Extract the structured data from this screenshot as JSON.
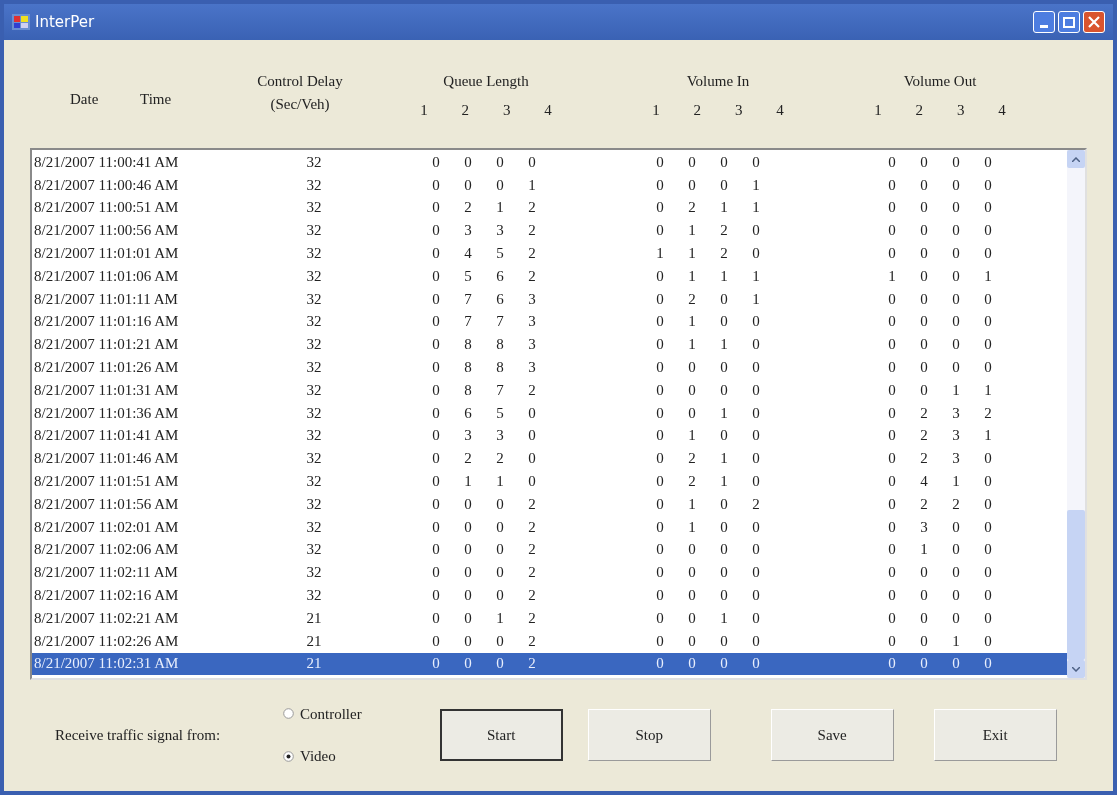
{
  "window": {
    "title": "InterPer"
  },
  "header": {
    "date": "Date",
    "time": "Time",
    "delay": [
      "Control Delay",
      "(Sec/Veh)"
    ],
    "groups": [
      {
        "title": "Queue Length",
        "lanes": [
          "1",
          "2",
          "3",
          "4"
        ]
      },
      {
        "title": "Volume In",
        "lanes": [
          "1",
          "2",
          "3",
          "4"
        ]
      },
      {
        "title": "Volume Out",
        "lanes": [
          "1",
          "2",
          "3",
          "4"
        ]
      }
    ]
  },
  "rows": [
    {
      "timestamp": "8/21/2007 11:00:41 AM",
      "delay": "32",
      "values": [
        "0",
        "0",
        "0",
        "0",
        "0",
        "0",
        "0",
        "0",
        "0",
        "0",
        "0",
        "0"
      ],
      "selected": false
    },
    {
      "timestamp": "8/21/2007 11:00:46 AM",
      "delay": "32",
      "values": [
        "0",
        "0",
        "0",
        "1",
        "0",
        "0",
        "0",
        "1",
        "0",
        "0",
        "0",
        "0"
      ],
      "selected": false
    },
    {
      "timestamp": "8/21/2007 11:00:51 AM",
      "delay": "32",
      "values": [
        "0",
        "2",
        "1",
        "2",
        "0",
        "2",
        "1",
        "1",
        "0",
        "0",
        "0",
        "0"
      ],
      "selected": false
    },
    {
      "timestamp": "8/21/2007 11:00:56 AM",
      "delay": "32",
      "values": [
        "0",
        "3",
        "3",
        "2",
        "0",
        "1",
        "2",
        "0",
        "0",
        "0",
        "0",
        "0"
      ],
      "selected": false
    },
    {
      "timestamp": "8/21/2007 11:01:01 AM",
      "delay": "32",
      "values": [
        "0",
        "4",
        "5",
        "2",
        "1",
        "1",
        "2",
        "0",
        "0",
        "0",
        "0",
        "0"
      ],
      "selected": false
    },
    {
      "timestamp": "8/21/2007 11:01:06 AM",
      "delay": "32",
      "values": [
        "0",
        "5",
        "6",
        "2",
        "0",
        "1",
        "1",
        "1",
        "1",
        "0",
        "0",
        "1"
      ],
      "selected": false
    },
    {
      "timestamp": "8/21/2007 11:01:11 AM",
      "delay": "32",
      "values": [
        "0",
        "7",
        "6",
        "3",
        "0",
        "2",
        "0",
        "1",
        "0",
        "0",
        "0",
        "0"
      ],
      "selected": false
    },
    {
      "timestamp": "8/21/2007 11:01:16 AM",
      "delay": "32",
      "values": [
        "0",
        "7",
        "7",
        "3",
        "0",
        "1",
        "0",
        "0",
        "0",
        "0",
        "0",
        "0"
      ],
      "selected": false
    },
    {
      "timestamp": "8/21/2007 11:01:21 AM",
      "delay": "32",
      "values": [
        "0",
        "8",
        "8",
        "3",
        "0",
        "1",
        "1",
        "0",
        "0",
        "0",
        "0",
        "0"
      ],
      "selected": false
    },
    {
      "timestamp": "8/21/2007 11:01:26 AM",
      "delay": "32",
      "values": [
        "0",
        "8",
        "8",
        "3",
        "0",
        "0",
        "0",
        "0",
        "0",
        "0",
        "0",
        "0"
      ],
      "selected": false
    },
    {
      "timestamp": "8/21/2007 11:01:31 AM",
      "delay": "32",
      "values": [
        "0",
        "8",
        "7",
        "2",
        "0",
        "0",
        "0",
        "0",
        "0",
        "0",
        "1",
        "1"
      ],
      "selected": false
    },
    {
      "timestamp": "8/21/2007 11:01:36 AM",
      "delay": "32",
      "values": [
        "0",
        "6",
        "5",
        "0",
        "0",
        "0",
        "1",
        "0",
        "0",
        "2",
        "3",
        "2"
      ],
      "selected": false
    },
    {
      "timestamp": "8/21/2007 11:01:41 AM",
      "delay": "32",
      "values": [
        "0",
        "3",
        "3",
        "0",
        "0",
        "1",
        "0",
        "0",
        "0",
        "2",
        "3",
        "1"
      ],
      "selected": false
    },
    {
      "timestamp": "8/21/2007 11:01:46 AM",
      "delay": "32",
      "values": [
        "0",
        "2",
        "2",
        "0",
        "0",
        "2",
        "1",
        "0",
        "0",
        "2",
        "3",
        "0"
      ],
      "selected": false
    },
    {
      "timestamp": "8/21/2007 11:01:51 AM",
      "delay": "32",
      "values": [
        "0",
        "1",
        "1",
        "0",
        "0",
        "2",
        "1",
        "0",
        "0",
        "4",
        "1",
        "0"
      ],
      "selected": false
    },
    {
      "timestamp": "8/21/2007 11:01:56 AM",
      "delay": "32",
      "values": [
        "0",
        "0",
        "0",
        "2",
        "0",
        "1",
        "0",
        "2",
        "0",
        "2",
        "2",
        "0"
      ],
      "selected": false
    },
    {
      "timestamp": "8/21/2007 11:02:01 AM",
      "delay": "32",
      "values": [
        "0",
        "0",
        "0",
        "2",
        "0",
        "1",
        "0",
        "0",
        "0",
        "3",
        "0",
        "0"
      ],
      "selected": false
    },
    {
      "timestamp": "8/21/2007 11:02:06 AM",
      "delay": "32",
      "values": [
        "0",
        "0",
        "0",
        "2",
        "0",
        "0",
        "0",
        "0",
        "0",
        "1",
        "0",
        "0"
      ],
      "selected": false
    },
    {
      "timestamp": "8/21/2007 11:02:11 AM",
      "delay": "32",
      "values": [
        "0",
        "0",
        "0",
        "2",
        "0",
        "0",
        "0",
        "0",
        "0",
        "0",
        "0",
        "0"
      ],
      "selected": false
    },
    {
      "timestamp": "8/21/2007 11:02:16 AM",
      "delay": "32",
      "values": [
        "0",
        "0",
        "0",
        "2",
        "0",
        "0",
        "0",
        "0",
        "0",
        "0",
        "0",
        "0"
      ],
      "selected": false
    },
    {
      "timestamp": "8/21/2007 11:02:21 AM",
      "delay": "21",
      "values": [
        "0",
        "0",
        "1",
        "2",
        "0",
        "0",
        "1",
        "0",
        "0",
        "0",
        "0",
        "0"
      ],
      "selected": false
    },
    {
      "timestamp": "8/21/2007 11:02:26 AM",
      "delay": "21",
      "values": [
        "0",
        "0",
        "0",
        "2",
        "0",
        "0",
        "0",
        "0",
        "0",
        "0",
        "1",
        "0"
      ],
      "selected": false
    },
    {
      "timestamp": "8/21/2007 11:02:31 AM",
      "delay": "21",
      "values": [
        "0",
        "0",
        "0",
        "2",
        "0",
        "0",
        "0",
        "0",
        "0",
        "0",
        "0",
        "0"
      ],
      "selected": true
    }
  ],
  "signal_source": {
    "label": "Receive traffic signal from:",
    "options": [
      {
        "label": "Controller",
        "selected": false
      },
      {
        "label": "Video",
        "selected": true
      }
    ]
  },
  "buttons": [
    {
      "label": "Start",
      "default": true
    },
    {
      "label": "Stop",
      "default": false
    },
    {
      "label": "Save",
      "default": false
    },
    {
      "label": "Exit",
      "default": false
    }
  ]
}
